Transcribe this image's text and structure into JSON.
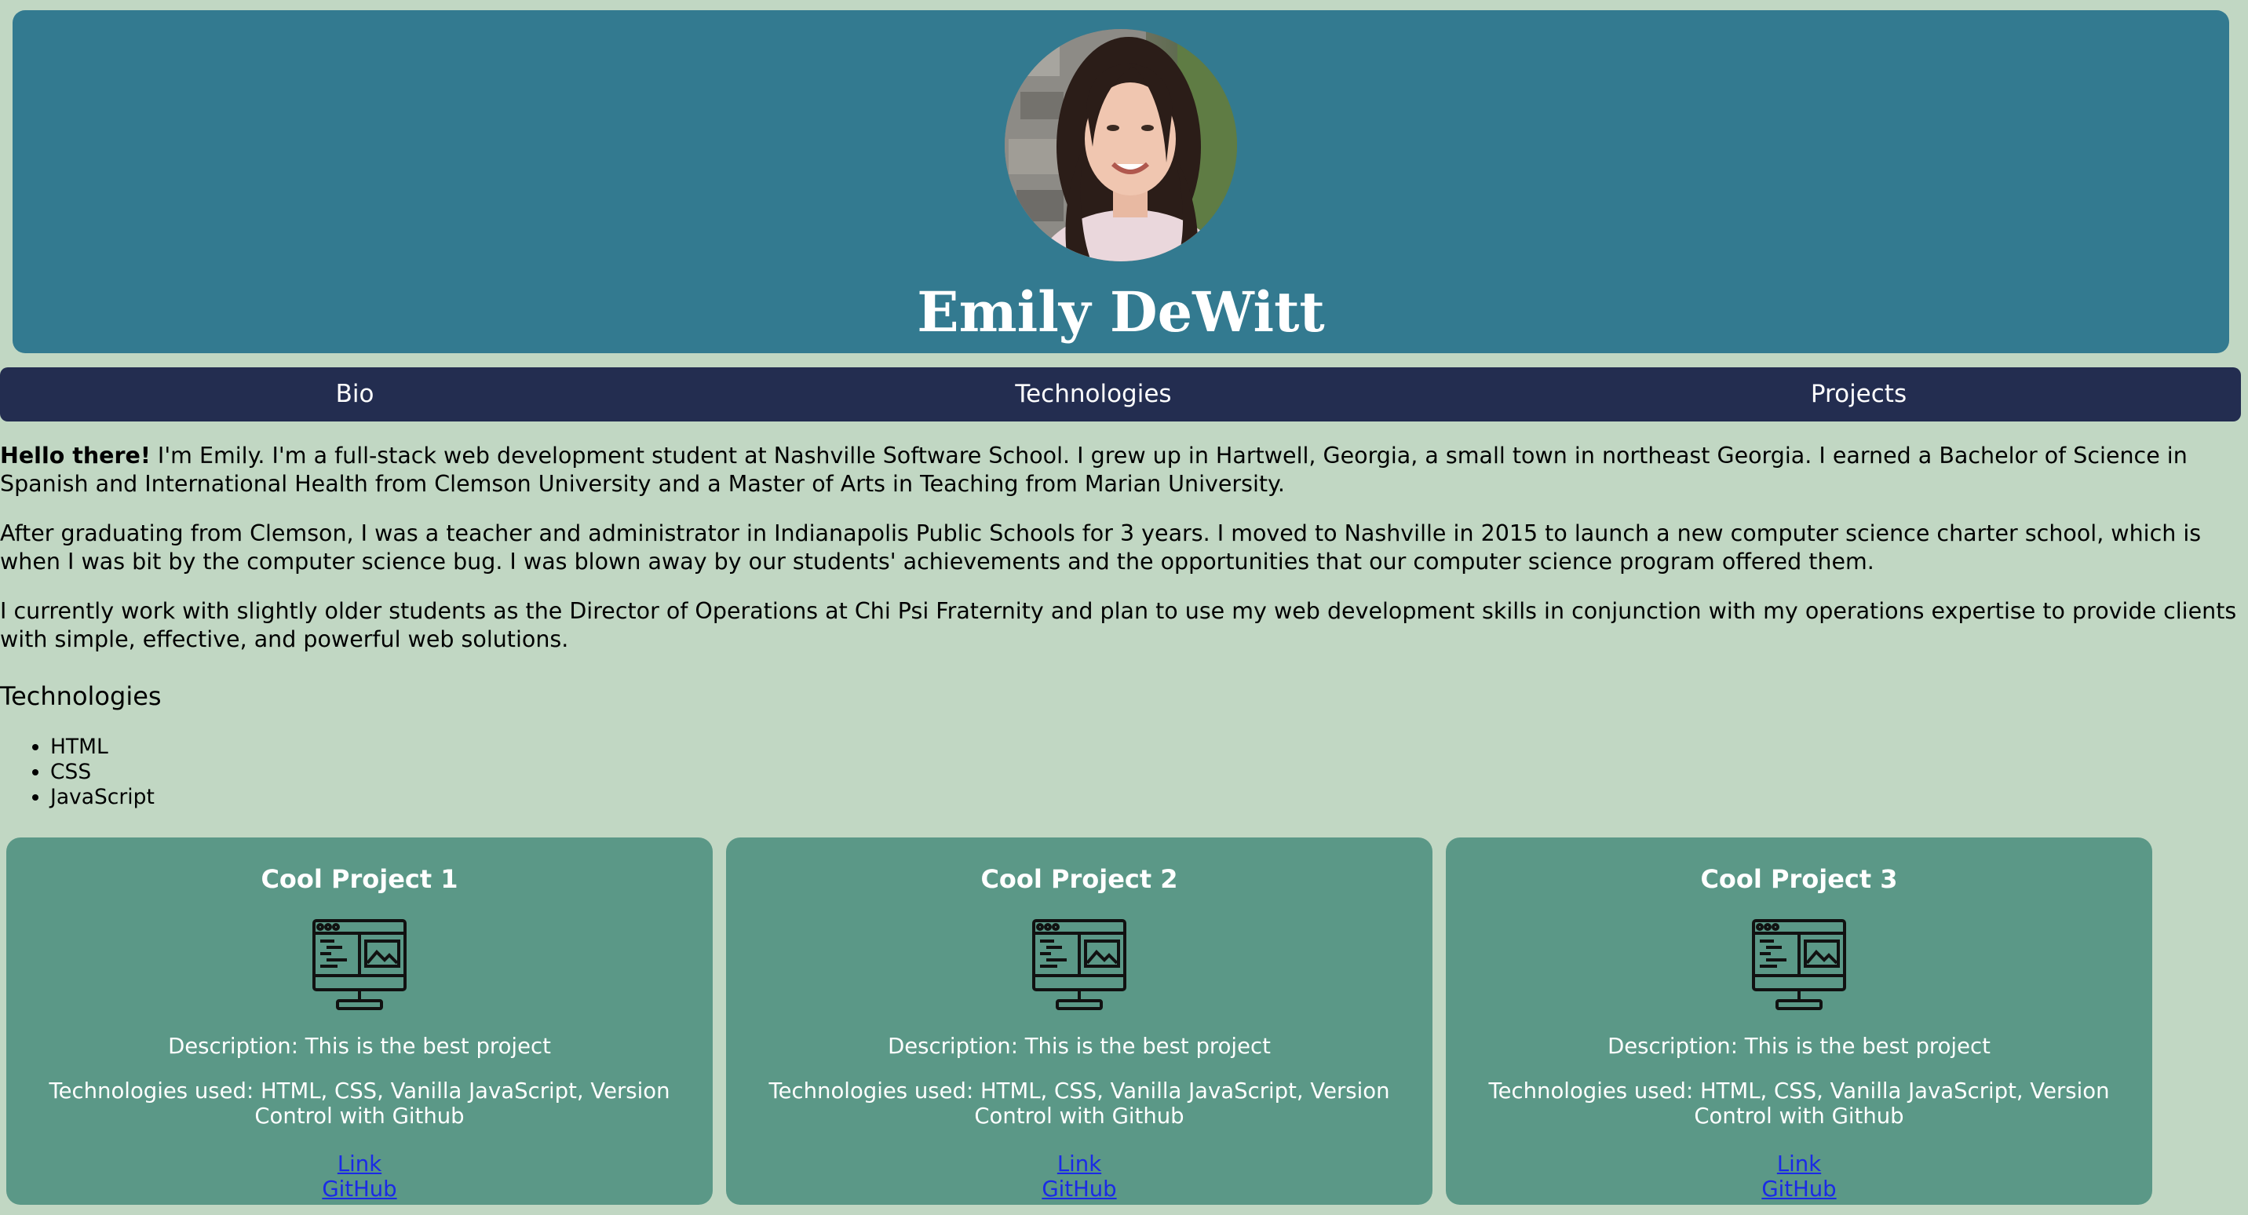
{
  "header": {
    "name": "Emily DeWitt",
    "avatar_icon": "profile-photo"
  },
  "nav": {
    "items": [
      "Bio",
      "Technologies",
      "Projects"
    ]
  },
  "bio": {
    "greeting": "Hello there!",
    "p1": " I'm Emily. I'm a full-stack web development student at Nashville Software School. I grew up in Hartwell, Georgia, a small town in northeast Georgia. I earned a Bachelor of Science in Spanish and International Health from Clemson University and a Master of Arts in Teaching from Marian University.",
    "p2": "After graduating from Clemson, I was a teacher and administrator in Indianapolis Public Schools for 3 years. I moved to Nashville in 2015 to launch a new computer science charter school, which is when I was bit by the computer science bug. I was blown away by our students' achievements and the opportunities that our computer science program offered them.",
    "p3": "I currently work with slightly older students as the Director of Operations at Chi Psi Fraternity and plan to use my web development skills in conjunction with my operations expertise to provide clients with simple, effective, and powerful web solutions."
  },
  "technologies": {
    "heading": "Technologies",
    "items": [
      "HTML",
      "CSS",
      "JavaScript"
    ]
  },
  "projects": [
    {
      "title": "Cool Project 1",
      "icon": "computer-monitor-icon",
      "description": "Description: This is the best project",
      "techs": "Technologies used: HTML, CSS, Vanilla JavaScript, Version Control with Github",
      "link_label": "Link",
      "github_label": "GitHub"
    },
    {
      "title": "Cool Project 2",
      "icon": "computer-monitor-icon",
      "description": "Description: This is the best project",
      "techs": "Technologies used: HTML, CSS, Vanilla JavaScript, Version Control with Github",
      "link_label": "Link",
      "github_label": "GitHub"
    },
    {
      "title": "Cool Project 3",
      "icon": "computer-monitor-icon",
      "description": "Description: This is the best project",
      "techs": "Technologies used: HTML, CSS, Vanilla JavaScript, Version Control with Github",
      "link_label": "Link",
      "github_label": "GitHub"
    }
  ],
  "colors": {
    "background": "#c1d7c3",
    "header": "#337a90",
    "nav": "#232d50",
    "card": "#5b9887",
    "link": "#1a2ae6"
  }
}
